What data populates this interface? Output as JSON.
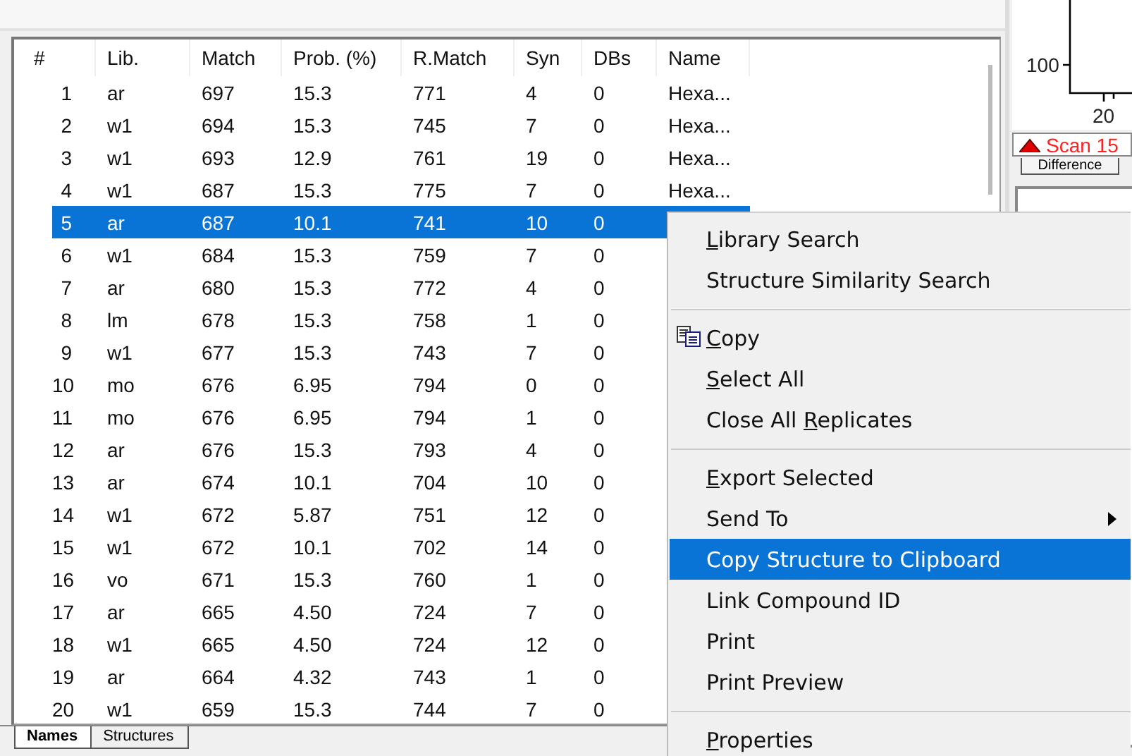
{
  "results": {
    "columns": [
      "#",
      "Lib.",
      "Match",
      "Prob. (%)",
      "R.Match",
      "Syn",
      "DBs",
      "Name"
    ],
    "rows": [
      {
        "cells": [
          "1",
          "ar",
          "697",
          "15.3",
          "771",
          "4",
          "0",
          "Hexa..."
        ],
        "selected": false
      },
      {
        "cells": [
          "2",
          "w1",
          "694",
          "15.3",
          "745",
          "7",
          "0",
          "Hexa..."
        ],
        "selected": false
      },
      {
        "cells": [
          "3",
          "w1",
          "693",
          "12.9",
          "761",
          "19",
          "0",
          "Hexa..."
        ],
        "selected": false
      },
      {
        "cells": [
          "4",
          "w1",
          "687",
          "15.3",
          "775",
          "7",
          "0",
          "Hexa..."
        ],
        "selected": false
      },
      {
        "cells": [
          "5",
          "ar",
          "687",
          "10.1",
          "741",
          "10",
          "0"
        ],
        "selected": true
      },
      {
        "cells": [
          "6",
          "w1",
          "684",
          "15.3",
          "759",
          "7",
          "0"
        ],
        "selected": false
      },
      {
        "cells": [
          "7",
          "ar",
          "680",
          "15.3",
          "772",
          "4",
          "0"
        ],
        "selected": false
      },
      {
        "cells": [
          "8",
          "lm",
          "678",
          "15.3",
          "758",
          "1",
          "0"
        ],
        "selected": false
      },
      {
        "cells": [
          "9",
          "w1",
          "677",
          "15.3",
          "743",
          "7",
          "0"
        ],
        "selected": false
      },
      {
        "cells": [
          "10",
          "mo",
          "676",
          "6.95",
          "794",
          "0",
          "0"
        ],
        "selected": false
      },
      {
        "cells": [
          "11",
          "mo",
          "676",
          "6.95",
          "794",
          "1",
          "0"
        ],
        "selected": false
      },
      {
        "cells": [
          "12",
          "ar",
          "676",
          "15.3",
          "793",
          "4",
          "0"
        ],
        "selected": false
      },
      {
        "cells": [
          "13",
          "ar",
          "674",
          "10.1",
          "704",
          "10",
          "0"
        ],
        "selected": false
      },
      {
        "cells": [
          "14",
          "w1",
          "672",
          "5.87",
          "751",
          "12",
          "0"
        ],
        "selected": false
      },
      {
        "cells": [
          "15",
          "w1",
          "672",
          "10.1",
          "702",
          "14",
          "0"
        ],
        "selected": false
      },
      {
        "cells": [
          "16",
          "vo",
          "671",
          "15.3",
          "760",
          "1",
          "0"
        ],
        "selected": false
      },
      {
        "cells": [
          "17",
          "ar",
          "665",
          "4.50",
          "724",
          "7",
          "0"
        ],
        "selected": false
      },
      {
        "cells": [
          "18",
          "w1",
          "665",
          "4.50",
          "724",
          "12",
          "0"
        ],
        "selected": false
      },
      {
        "cells": [
          "19",
          "ar",
          "664",
          "4.32",
          "743",
          "1",
          "0"
        ],
        "selected": false
      },
      {
        "cells": [
          "20",
          "w1",
          "659",
          "15.3",
          "744",
          "7",
          "0"
        ],
        "selected": false
      }
    ]
  },
  "bottom_tabs": [
    {
      "label": "Names",
      "selected": true
    },
    {
      "label": "Structures",
      "selected": false
    }
  ],
  "spectrum": {
    "y_tick": "100",
    "x_tick": "20",
    "scan_label": "Scan 15",
    "tab": "Difference"
  },
  "context_menu": [
    {
      "kind": "item",
      "key": "L",
      "after": "ibrary Search",
      "selected": false
    },
    {
      "kind": "item",
      "before": "Structure Similarity Search",
      "selected": false
    },
    {
      "kind": "separator"
    },
    {
      "kind": "item",
      "key": "C",
      "after": "opy",
      "icon": true,
      "selected": false
    },
    {
      "kind": "item",
      "key": "S",
      "after": "elect All",
      "selected": false
    },
    {
      "kind": "item",
      "before": "Close All ",
      "key": "R",
      "after": "eplicates",
      "selected": false
    },
    {
      "kind": "separator"
    },
    {
      "kind": "item",
      "key": "E",
      "after": "xport Selected",
      "selected": false
    },
    {
      "kind": "item",
      "before": "Send To",
      "submenu": true,
      "selected": false
    },
    {
      "kind": "item",
      "before": "Copy Structure to Clipboard",
      "selected": true
    },
    {
      "kind": "item",
      "before": "Link Compound ID",
      "selected": false
    },
    {
      "kind": "item",
      "before": "Print",
      "selected": false
    },
    {
      "kind": "item",
      "before": "Print Preview",
      "selected": false
    },
    {
      "kind": "separator"
    },
    {
      "kind": "item",
      "key": "P",
      "after": "roperties",
      "selected": false
    }
  ]
}
